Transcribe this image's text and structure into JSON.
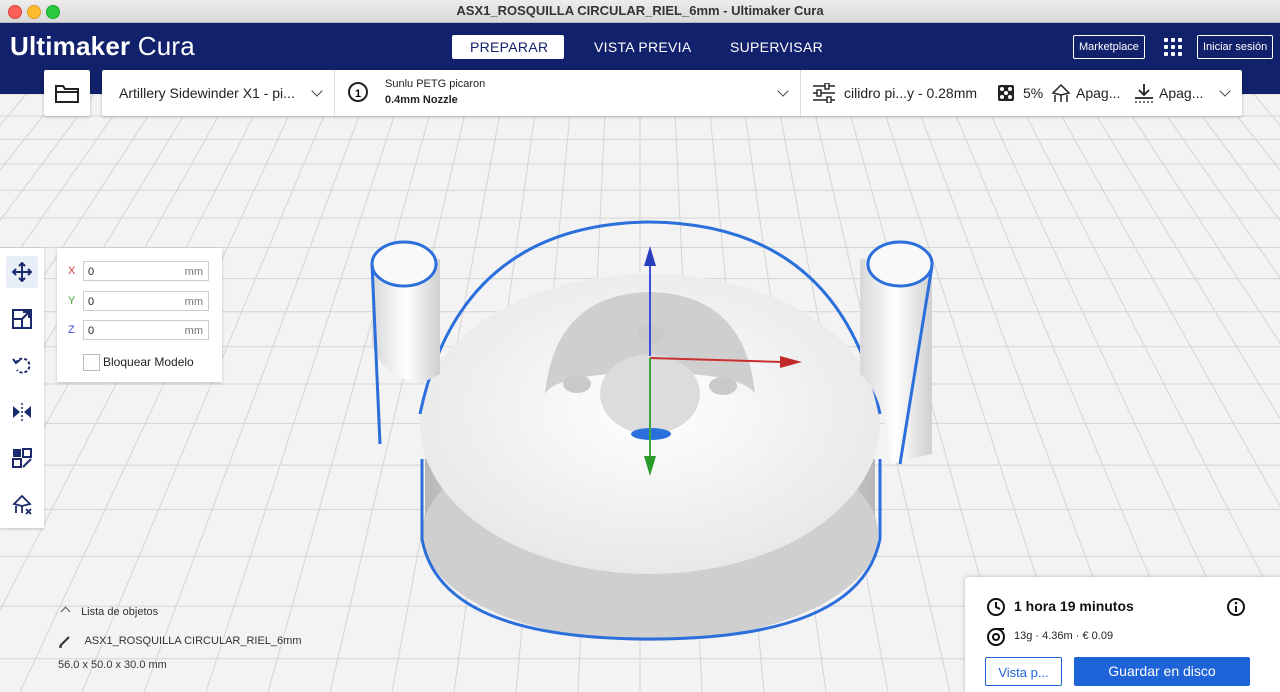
{
  "window": {
    "title": "ASX1_ROSQUILLA CIRCULAR_RIEL_6mm - Ultimaker Cura"
  },
  "header": {
    "logo_bold": "Ultimaker",
    "logo_light": "Cura",
    "tabs": [
      {
        "label": "PREPARAR",
        "active": true
      },
      {
        "label": "VISTA PREVIA",
        "active": false
      },
      {
        "label": "SUPERVISAR",
        "active": false
      }
    ],
    "marketplace_label": "Marketplace",
    "signin_label": "Iniciar sesión",
    "brand_color": "#12216b"
  },
  "toolbar": {
    "printer_label": "Artillery Sidewinder X1 - pi...",
    "extruder_number": "1",
    "material_name": "Sunlu PETG picaron",
    "nozzle_label": "0.4mm Nozzle",
    "profile_label": "cilidro pi...y - 0.28mm",
    "infill_label": "5%",
    "support_label": "Apag...",
    "adhesion_label": "Apag..."
  },
  "tools": {
    "items": [
      "move-icon",
      "scale-icon",
      "rotate-icon",
      "mirror-icon",
      "per-model-settings-icon",
      "support-blocker-icon"
    ]
  },
  "move_panel": {
    "x_label": "X",
    "x_value": "0",
    "x_unit": "mm",
    "y_label": "Y",
    "y_value": "0",
    "y_unit": "mm",
    "z_label": "Z",
    "z_value": "0",
    "z_unit": "mm",
    "lock_label": "Bloquear Modelo",
    "x_color": "#d93a3a",
    "y_color": "#3aa83a",
    "z_color": "#3a4fd9"
  },
  "object_list": {
    "header": "Lista de objetos",
    "object_name": "ASX1_ROSQUILLA CIRCULAR_RIEL_6mm",
    "dimensions": "56.0 x 50.0 x 30.0 mm"
  },
  "print_panel": {
    "time": "1 hora 19 minutos",
    "material_info": "13g · 4.36m · € 0.09",
    "preview_label": "Vista p...",
    "save_label": "Guardar en disco",
    "accent_color": "#1f63d8"
  }
}
